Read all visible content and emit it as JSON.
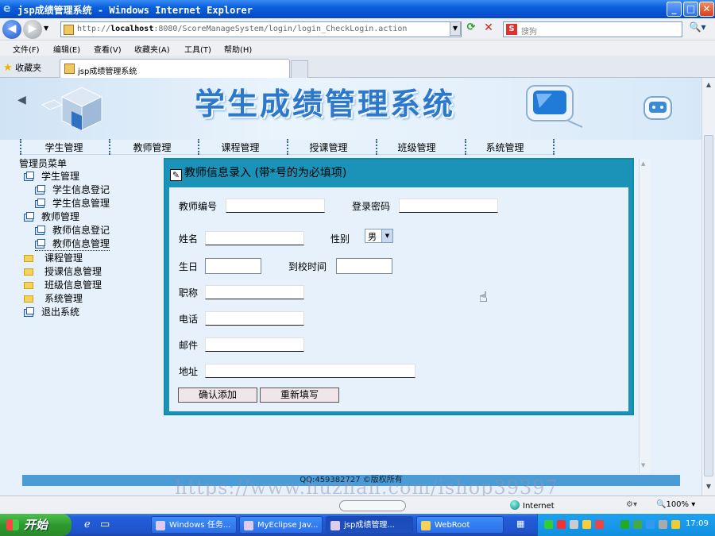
{
  "window": {
    "title": "jsp成绩管理系统 - Windows Internet Explorer",
    "minimize": "_",
    "maximize": "□",
    "close": "✕"
  },
  "address": {
    "url_prefix": "http://",
    "url_host": "localhost",
    "url_rest": ":8080/ScoreManageSystem/login/login_CheckLogin.action"
  },
  "search": {
    "placeholder": "搜狗",
    "engine_icon": "S"
  },
  "menu": [
    "文件(F)",
    "编辑(E)",
    "查看(V)",
    "收藏夹(A)",
    "工具(T)",
    "帮助(H)"
  ],
  "favorites_label": "收藏夹",
  "tab_title": "jsp成绩管理系统",
  "banner_title": "学生成绩管理系统",
  "nav": [
    "学生管理",
    "教师管理",
    "课程管理",
    "授课管理",
    "班级管理",
    "系统管理"
  ],
  "sidebar": {
    "title": "管理员菜单",
    "items": [
      {
        "label": "学生管理",
        "level": 1,
        "icon": "page-icon"
      },
      {
        "label": "学生信息登记",
        "level": 2,
        "icon": "page-icon"
      },
      {
        "label": "学生信息管理",
        "level": 2,
        "icon": "page-icon"
      },
      {
        "label": "教师管理",
        "level": 1,
        "icon": "page-icon"
      },
      {
        "label": "教师信息登记",
        "level": 2,
        "icon": "page-icon"
      },
      {
        "label": "教师信息管理",
        "level": 2,
        "icon": "page-icon"
      },
      {
        "label": "课程管理",
        "level": 1,
        "icon": "folder-icon"
      },
      {
        "label": "授课信息管理",
        "level": 1,
        "icon": "folder-icon"
      },
      {
        "label": "班级信息管理",
        "level": 1,
        "icon": "folder-icon"
      },
      {
        "label": "系统管理",
        "level": 1,
        "icon": "folder-icon"
      },
      {
        "label": "退出系统",
        "level": 1,
        "icon": "page-icon"
      }
    ]
  },
  "form": {
    "title": "教师信息录入 (带*号的为必填项)",
    "teacher_id_label": "教师编号",
    "password_label": "登录密码",
    "name_label": "姓名",
    "sex_label": "性别",
    "sex_value": "男",
    "birthday_label": "生日",
    "arrival_label": "到校时间",
    "title_label": "职称",
    "phone_label": "电话",
    "email_label": "邮件",
    "address_label": "地址",
    "submit_label": "确认添加",
    "reset_label": "重新填写"
  },
  "footer": "QQ:459382727 ©版权所有",
  "status": {
    "zone": "Internet",
    "zoom": "100%"
  },
  "watermark": "https://www.huzhan.com/ishop39397",
  "taskbar": {
    "start": "开始",
    "tasks": [
      "Windows 任务...",
      "MyEclipse Jav...",
      "jsp成绩管理...",
      "WebRoot"
    ],
    "active_task": 2,
    "clock": "17:09"
  },
  "colors": {
    "panel_border": "#1b92b8",
    "page_bg": "#e6f1fb",
    "banner_title": "#2b78cc",
    "footer_bar": "#4a9bd6"
  }
}
